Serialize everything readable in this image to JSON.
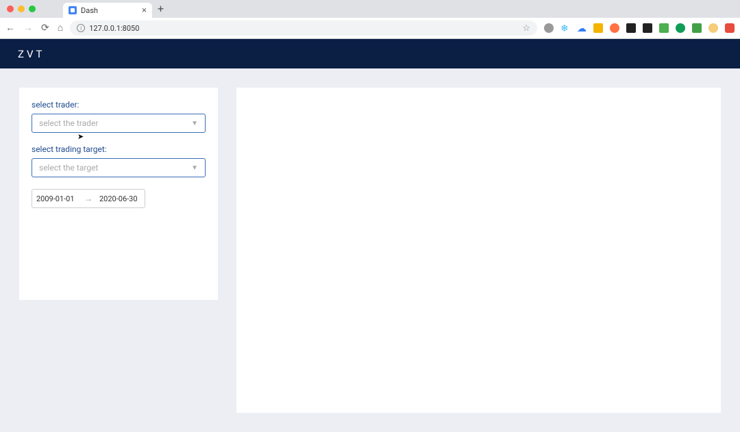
{
  "browser": {
    "tab_title": "Dash",
    "url": "127.0.0.1:8050"
  },
  "header": {
    "brand": "ZVT"
  },
  "sidebar": {
    "trader_label": "select trader:",
    "trader_placeholder": "select the trader",
    "target_label": "select trading target:",
    "target_placeholder": "select the target",
    "date_start": "2009-01-01",
    "date_end": "2020-06-30"
  },
  "extensions": {
    "colors": [
      "#999",
      "#3cbbf0",
      "#2e7df6",
      "#f4b400",
      "#ff7043",
      "#222",
      "#222",
      "#4caf50",
      "#0f9d58",
      "#43a047",
      "#f5cd79",
      "#e74c3c"
    ]
  }
}
